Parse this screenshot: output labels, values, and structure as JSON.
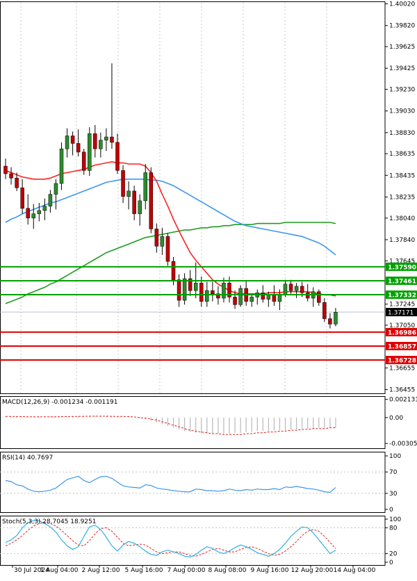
{
  "chart_data": [
    {
      "type": "candlestick",
      "title": "",
      "instrument_chart": "price",
      "y_ticks": [
        "1.40020",
        "1.39820",
        "1.39625",
        "1.39425",
        "1.39230",
        "1.39030",
        "1.38830",
        "1.38635",
        "1.38435",
        "1.38235",
        "1.38040",
        "1.37840",
        "1.37645",
        "1.37245",
        "1.37050",
        "1.36655",
        "1.36455"
      ],
      "ylim": [
        1.3642,
        1.4003
      ],
      "x_ticks": [
        "30 Jul 2024",
        "1 Aug 04:00",
        "2 Aug 12:00",
        "5 Aug 16:00",
        "7 Aug 00:00",
        "8 Aug 08:00",
        "9 Aug 16:00",
        "12 Aug 20:00",
        "14 Aug 04:00"
      ],
      "current_price": "1.37171",
      "levels": [
        {
          "label": "1.37590",
          "value": 1.3759,
          "color": "#00a000"
        },
        {
          "label": "1.37461",
          "value": 1.37461,
          "color": "#00a000"
        },
        {
          "label": "1.37332",
          "value": 1.37332,
          "color": "#00a000"
        },
        {
          "label": "1.36986",
          "value": 1.36986,
          "color": "#e00000"
        },
        {
          "label": "1.36857",
          "value": 1.36857,
          "color": "#e00000"
        },
        {
          "label": "1.36728",
          "value": 1.36728,
          "color": "#e00000"
        }
      ],
      "colors": {
        "bull": "#2e8b2e",
        "bear": "#c00000",
        "ma_fast": "#ff2020",
        "ma_mid": "#3c96f0",
        "ma_slow": "#1e9b1e"
      },
      "candles": [
        [
          1.3852,
          1.3859,
          1.384,
          1.3845
        ],
        [
          1.3845,
          1.3851,
          1.3835,
          1.3841
        ],
        [
          1.3841,
          1.3846,
          1.3829,
          1.3832
        ],
        [
          1.3832,
          1.384,
          1.3808,
          1.3813
        ],
        [
          1.3813,
          1.3826,
          1.3798,
          1.3804
        ],
        [
          1.3804,
          1.3817,
          1.3794,
          1.3808
        ],
        [
          1.3808,
          1.3818,
          1.3801,
          1.3811
        ],
        [
          1.3811,
          1.3822,
          1.3802,
          1.3815
        ],
        [
          1.3815,
          1.383,
          1.3809,
          1.3826
        ],
        [
          1.3826,
          1.384,
          1.3812,
          1.3836
        ],
        [
          1.3836,
          1.3874,
          1.383,
          1.3868
        ],
        [
          1.3868,
          1.3887,
          1.386,
          1.388
        ],
        [
          1.388,
          1.3884,
          1.3862,
          1.3873
        ],
        [
          1.3873,
          1.3886,
          1.3861,
          1.3865
        ],
        [
          1.3865,
          1.3868,
          1.3844,
          1.3848
        ],
        [
          1.3848,
          1.3888,
          1.3843,
          1.3882
        ],
        [
          1.3882,
          1.389,
          1.386,
          1.3868
        ],
        [
          1.3868,
          1.3883,
          1.386,
          1.3876
        ],
        [
          1.3876,
          1.3887,
          1.3866,
          1.3879
        ],
        [
          1.3879,
          1.3947,
          1.3868,
          1.3874
        ],
        [
          1.3874,
          1.3882,
          1.3845,
          1.3848
        ],
        [
          1.3848,
          1.3853,
          1.3818,
          1.3824
        ],
        [
          1.3824,
          1.3838,
          1.3812,
          1.3829
        ],
        [
          1.3829,
          1.3834,
          1.3802,
          1.3808
        ],
        [
          1.3808,
          1.3826,
          1.3797,
          1.382
        ],
        [
          1.382,
          1.3854,
          1.3812,
          1.3846
        ],
        [
          1.3846,
          1.3851,
          1.379,
          1.3794
        ],
        [
          1.3794,
          1.3799,
          1.3772,
          1.3778
        ],
        [
          1.3778,
          1.3795,
          1.377,
          1.3787
        ],
        [
          1.3787,
          1.379,
          1.376,
          1.3764
        ],
        [
          1.3764,
          1.3768,
          1.3742,
          1.3747
        ],
        [
          1.3747,
          1.3752,
          1.3722,
          1.3728
        ],
        [
          1.3728,
          1.3753,
          1.3724,
          1.3748
        ],
        [
          1.3748,
          1.3756,
          1.3732,
          1.3737
        ],
        [
          1.3737,
          1.3763,
          1.373,
          1.3744
        ],
        [
          1.3744,
          1.375,
          1.3722,
          1.3727
        ],
        [
          1.3727,
          1.3745,
          1.3722,
          1.3737
        ],
        [
          1.3737,
          1.3745,
          1.3727,
          1.3734
        ],
        [
          1.3734,
          1.3741,
          1.3724,
          1.373
        ],
        [
          1.373,
          1.3749,
          1.3726,
          1.3744
        ],
        [
          1.3744,
          1.375,
          1.3726,
          1.3731
        ],
        [
          1.3731,
          1.3737,
          1.372,
          1.3724
        ],
        [
          1.3724,
          1.3742,
          1.3722,
          1.3739
        ],
        [
          1.3739,
          1.3746,
          1.3723,
          1.3727
        ],
        [
          1.3727,
          1.3734,
          1.3722,
          1.3731
        ],
        [
          1.3731,
          1.3738,
          1.3724,
          1.3735
        ],
        [
          1.3735,
          1.3742,
          1.3726,
          1.3729
        ],
        [
          1.3729,
          1.3736,
          1.3722,
          1.3733
        ],
        [
          1.3733,
          1.3742,
          1.3723,
          1.3727
        ],
        [
          1.3727,
          1.3738,
          1.3719,
          1.3733
        ],
        [
          1.3733,
          1.3747,
          1.3731,
          1.3743
        ],
        [
          1.3743,
          1.3747,
          1.3734,
          1.3737
        ],
        [
          1.3737,
          1.3744,
          1.373,
          1.3741
        ],
        [
          1.3741,
          1.3745,
          1.3731,
          1.3735
        ],
        [
          1.3735,
          1.3743,
          1.3727,
          1.373
        ],
        [
          1.373,
          1.374,
          1.3722,
          1.3736
        ],
        [
          1.3736,
          1.3738,
          1.3723,
          1.3726
        ],
        [
          1.3726,
          1.373,
          1.3708,
          1.3711
        ],
        [
          1.3711,
          1.3716,
          1.3702,
          1.3706
        ],
        [
          1.3706,
          1.3721,
          1.3704,
          1.3717
        ]
      ],
      "ma_fast": [
        1.3848,
        1.3846,
        1.3844,
        1.3842,
        1.3841,
        1.384,
        1.384,
        1.384,
        1.3841,
        1.3843,
        1.3845,
        1.3846,
        1.3847,
        1.3848,
        1.3849,
        1.3851,
        1.3853,
        1.3854,
        1.3855,
        1.3856,
        1.3855,
        1.3855,
        1.3854,
        1.3854,
        1.3854,
        1.3852,
        1.3846,
        1.3838,
        1.3826,
        1.3815,
        1.3803,
        1.3792,
        1.3782,
        1.3772,
        1.3765,
        1.3759,
        1.3753,
        1.3747,
        1.3743,
        1.374,
        1.3737,
        1.3735,
        1.3734,
        1.3734,
        1.3734,
        1.3734,
        1.3734,
        1.3735,
        1.3735,
        1.3735,
        1.3736,
        1.3736,
        1.3736,
        1.3736,
        1.3736,
        1.3735,
        1.3734,
        1.3733,
        1.3733,
        1.3732
      ],
      "ma_mid": [
        1.38,
        1.3803,
        1.3805,
        1.3808,
        1.381,
        1.3812,
        1.3814,
        1.3816,
        1.3818,
        1.3819,
        1.3821,
        1.3823,
        1.3825,
        1.3827,
        1.3829,
        1.3831,
        1.3833,
        1.3835,
        1.3837,
        1.3838,
        1.3839,
        1.384,
        1.384,
        1.384,
        1.384,
        1.384,
        1.3839,
        1.3839,
        1.3838,
        1.3836,
        1.3834,
        1.3831,
        1.3828,
        1.3825,
        1.3822,
        1.3819,
        1.3816,
        1.3813,
        1.381,
        1.3807,
        1.3804,
        1.3801,
        1.3799,
        1.3797,
        1.3796,
        1.3795,
        1.3794,
        1.3793,
        1.3792,
        1.3791,
        1.379,
        1.3789,
        1.3788,
        1.3787,
        1.3785,
        1.3783,
        1.3781,
        1.3778,
        1.3774,
        1.377
      ],
      "ma_slow": [
        1.3725,
        1.3727,
        1.3729,
        1.3731,
        1.3734,
        1.3736,
        1.3738,
        1.374,
        1.3743,
        1.3745,
        1.3748,
        1.3751,
        1.3754,
        1.3757,
        1.376,
        1.3763,
        1.3766,
        1.3769,
        1.3772,
        1.3774,
        1.3776,
        1.3778,
        1.378,
        1.3782,
        1.3784,
        1.3786,
        1.3787,
        1.3788,
        1.3789,
        1.379,
        1.3791,
        1.3792,
        1.3793,
        1.3793,
        1.3794,
        1.3795,
        1.3795,
        1.3796,
        1.3796,
        1.3797,
        1.3797,
        1.3798,
        1.3798,
        1.3798,
        1.3798,
        1.3799,
        1.3799,
        1.3799,
        1.3799,
        1.3799,
        1.38,
        1.38,
        1.38,
        1.38,
        1.38,
        1.38,
        1.38,
        1.38,
        1.38,
        1.3799
      ]
    },
    {
      "type": "histogram-line",
      "indicator": "MACD",
      "label": "MACD(12,26,9) -0.001234 -0.001191",
      "y_ticks": [
        "0.002131",
        "0.00",
        "-0.003052"
      ],
      "ylim": [
        -0.00345,
        0.00235
      ],
      "histogram": [
        0.00012,
        0.0001,
        9e-05,
        8e-05,
        8e-05,
        8e-05,
        9e-05,
        9e-05,
        0.0001,
        0.00011,
        0.00012,
        0.00014,
        0.00015,
        0.00016,
        0.00016,
        0.00015,
        0.00015,
        0.00015,
        0.00014,
        0.00013,
        0.00011,
        8e-05,
        4e-05,
        0.0,
        -0.0001,
        -0.0002,
        -0.0004,
        -0.0006,
        -0.0008,
        -0.001,
        -0.0012,
        -0.0014,
        -0.0016,
        -0.0017,
        -0.0018,
        -0.0019,
        -0.0019,
        -0.0019,
        -0.0019,
        -0.0019,
        -0.0019,
        -0.0018,
        -0.0018,
        -0.0017,
        -0.0017,
        -0.0016,
        -0.0016,
        -0.0016,
        -0.0015,
        -0.0015,
        -0.0015,
        -0.0014,
        -0.0014,
        -0.0013,
        -0.0013,
        -0.0013,
        -0.0012,
        -0.0012,
        -0.0012,
        -0.0012
      ],
      "signal": [
        0.00012,
        0.00012,
        0.00011,
        0.0001,
        9e-05,
        8e-05,
        8e-05,
        8e-05,
        8e-05,
        9e-05,
        0.0001,
        0.00011,
        0.00012,
        0.00013,
        0.00014,
        0.00015,
        0.00015,
        0.00015,
        0.00015,
        0.00014,
        0.00013,
        0.00012,
        0.0001,
        6e-05,
        0.0,
        -8e-05,
        -0.0002,
        -0.0003,
        -0.0005,
        -0.0007,
        -0.0009,
        -0.0011,
        -0.0013,
        -0.0015,
        -0.0016,
        -0.0017,
        -0.0018,
        -0.0019,
        -0.0019,
        -0.002,
        -0.002,
        -0.002,
        -0.002,
        -0.0019,
        -0.0019,
        -0.0018,
        -0.0018,
        -0.0017,
        -0.0017,
        -0.0016,
        -0.0016,
        -0.0015,
        -0.0015,
        -0.0014,
        -0.0014,
        -0.0013,
        -0.0013,
        -0.0013,
        -0.0012,
        -0.0012
      ]
    },
    {
      "type": "line",
      "indicator": "RSI",
      "label": "RSI(14) 40.7697",
      "y_ticks": [
        "100",
        "70",
        "30",
        "0"
      ],
      "ylim": [
        0,
        100
      ],
      "values": [
        54,
        52,
        46,
        44,
        38,
        34,
        33,
        34,
        36,
        40,
        48,
        56,
        59,
        62,
        54,
        50,
        56,
        61,
        62,
        58,
        51,
        44,
        42,
        41,
        40,
        46,
        45,
        40,
        38,
        37,
        35,
        34,
        33,
        33,
        38,
        37,
        35,
        35,
        34,
        35,
        38,
        36,
        35,
        37,
        36,
        38,
        37,
        37,
        39,
        37,
        42,
        41,
        43,
        41,
        39,
        38,
        36,
        33,
        32,
        41
      ]
    },
    {
      "type": "line",
      "indicator": "Stochastic",
      "label": "Stoch(5,3,3) 28.7045 18.9251",
      "y_ticks": [
        "100",
        "80",
        "20",
        "0"
      ],
      "ylim": [
        0,
        100
      ],
      "k": [
        46,
        52,
        62,
        80,
        92,
        97,
        96,
        90,
        82,
        70,
        52,
        38,
        30,
        36,
        60,
        82,
        86,
        76,
        58,
        38,
        26,
        40,
        48,
        44,
        36,
        26,
        18,
        16,
        24,
        28,
        24,
        20,
        14,
        12,
        18,
        28,
        36,
        32,
        24,
        20,
        26,
        34,
        40,
        36,
        30,
        22,
        18,
        14,
        20,
        30,
        44,
        60,
        72,
        82,
        80,
        68,
        52,
        36,
        20,
        28
      ],
      "d": [
        38,
        44,
        52,
        62,
        74,
        84,
        90,
        92,
        90,
        84,
        74,
        62,
        50,
        40,
        38,
        50,
        66,
        78,
        80,
        72,
        58,
        44,
        38,
        40,
        42,
        40,
        32,
        24,
        20,
        22,
        24,
        24,
        20,
        16,
        14,
        18,
        24,
        30,
        32,
        28,
        24,
        24,
        30,
        34,
        36,
        32,
        26,
        20,
        16,
        18,
        26,
        36,
        48,
        62,
        72,
        76,
        72,
        60,
        46,
        32
      ]
    }
  ]
}
